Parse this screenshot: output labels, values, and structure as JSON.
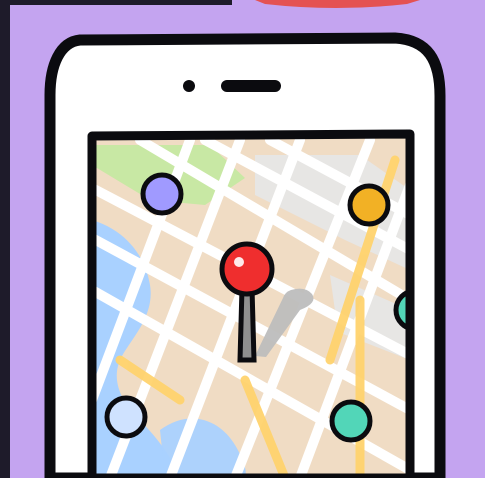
{
  "illustration": {
    "subject": "smartphone-map-pin",
    "colors": {
      "background": "#c4a4f0",
      "frame_dark": "#1e1b2a",
      "phone_body": "#ffffff",
      "outline": "#0b0b0f",
      "map_land": "#f0dcc4",
      "map_water": "#a9d1ff",
      "map_park": "#c8e8a4",
      "map_roads": "#ffffff",
      "map_gray": "#e6e6e6",
      "accent_yellow": "#ffd36e",
      "pin_red": "#ef2e2e",
      "pin_shadow": "#bdbdbd",
      "top_red_shape": "#e45252"
    },
    "icons": [
      "phone-outline-icon",
      "speaker-slot-icon",
      "camera-dot-icon",
      "map-pin-icon",
      "purple-dot-icon",
      "orange-dot-icon",
      "teal-dot-icon",
      "light-blue-dot-icon"
    ]
  }
}
